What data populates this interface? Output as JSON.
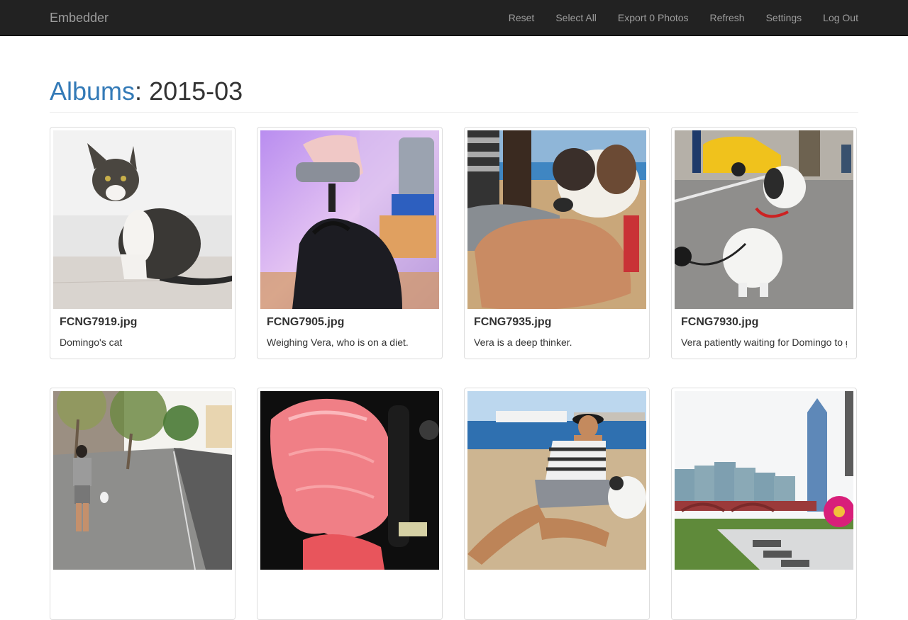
{
  "navbar": {
    "brand": "Embedder",
    "items": [
      {
        "label": "Reset"
      },
      {
        "label": "Select All"
      },
      {
        "label": "Export 0 Photos"
      },
      {
        "label": "Refresh"
      },
      {
        "label": "Settings"
      },
      {
        "label": "Log Out"
      }
    ]
  },
  "header": {
    "link": "Albums",
    "separator": ": ",
    "album": "2015-03"
  },
  "photos": [
    {
      "filename": "FCNG7919.jpg",
      "caption": "Domingo's cat"
    },
    {
      "filename": "FCNG7905.jpg",
      "caption": "Weighing Vera, who is on a diet."
    },
    {
      "filename": "FCNG7935.jpg",
      "caption": "Vera is a deep thinker."
    },
    {
      "filename": "FCNG7930.jpg",
      "caption": "Vera patiently waiting for Domingo to g"
    },
    {
      "filename": "",
      "caption": ""
    },
    {
      "filename": "",
      "caption": ""
    },
    {
      "filename": "",
      "caption": ""
    },
    {
      "filename": "",
      "caption": ""
    }
  ],
  "colors": {
    "navbar_bg": "#222222",
    "navbar_text": "#9d9d9d",
    "link": "#337ab7"
  }
}
